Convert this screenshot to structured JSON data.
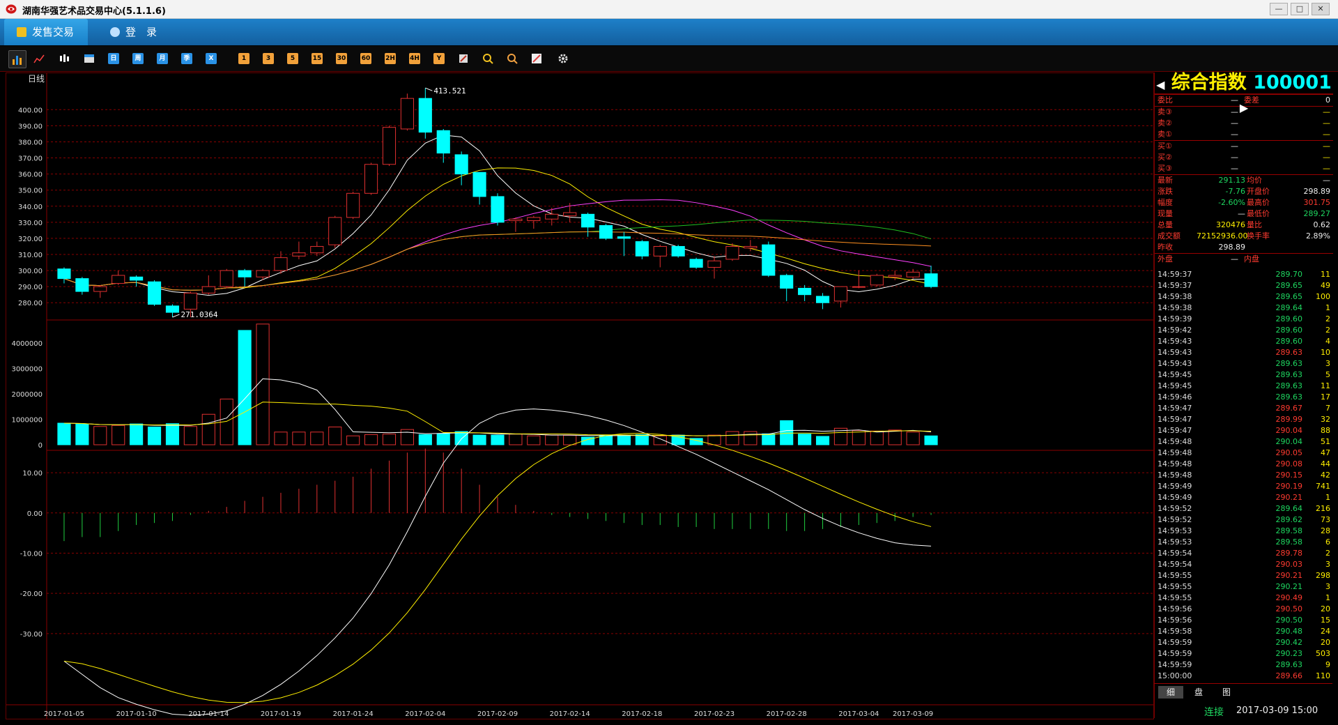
{
  "window": {
    "title": "湖南华强艺术品交易中心(5.1.1.6)",
    "minimize": "—",
    "maximize": "□",
    "close": "✕"
  },
  "nav": {
    "sell_label": "发售交易",
    "login_label": "登　录"
  },
  "toolbar": {
    "periods": [
      "日",
      "周",
      "月",
      "季",
      "X"
    ],
    "minutes": [
      "1",
      "3",
      "5",
      "15",
      "30",
      "60",
      "2H",
      "4H",
      "Y"
    ]
  },
  "chart": {
    "period_label": "日线",
    "high_label": "413.521",
    "low_label": "271.0364"
  },
  "chart_data": {
    "type": "candlestick",
    "price_axis": {
      "ticks": [
        "400.00",
        "390.00",
        "380.00",
        "370.00",
        "360.00",
        "350.00",
        "340.00",
        "330.00",
        "320.00",
        "310.00",
        "300.00",
        "290.00",
        "280.00"
      ],
      "ylim": [
        271,
        414
      ]
    },
    "volume_axis": {
      "ticks": [
        "4000000",
        "3000000",
        "2000000",
        "1000000",
        "0"
      ],
      "ylim": [
        0,
        4800000
      ]
    },
    "macd_axis": {
      "ticks": [
        "10.00",
        "0.00",
        "-10.00",
        "-20.00",
        "-30.00"
      ],
      "ylim": [
        -38,
        14
      ]
    },
    "date_labels": [
      "2017-01-05",
      "2017-01-10",
      "2017-01-14",
      "2017-01-19",
      "2017-01-24",
      "2017-02-04",
      "2017-02-09",
      "2017-02-14",
      "2017-02-18",
      "2017-02-23",
      "2017-02-28",
      "2017-03-04",
      "2017-03-09"
    ],
    "candles": [
      [
        301,
        295,
        302,
        292
      ],
      [
        295,
        287,
        296,
        285
      ],
      [
        287,
        290,
        291,
        283
      ],
      [
        292,
        297,
        300,
        291
      ],
      [
        296,
        294,
        297,
        290
      ],
      [
        293,
        279,
        294,
        278
      ],
      [
        278,
        274,
        279,
        271
      ],
      [
        276,
        286,
        287,
        271
      ],
      [
        286,
        290,
        297,
        285
      ],
      [
        290,
        300,
        301,
        289
      ],
      [
        300,
        296,
        301,
        290
      ],
      [
        296,
        300,
        301,
        294
      ],
      [
        300,
        308,
        312,
        298
      ],
      [
        309,
        311,
        318,
        307
      ],
      [
        311,
        315,
        318,
        309
      ],
      [
        316,
        333,
        334,
        314
      ],
      [
        333,
        348,
        349,
        332
      ],
      [
        348,
        366,
        367,
        347
      ],
      [
        366,
        389,
        390,
        365
      ],
      [
        388,
        407,
        410,
        387
      ],
      [
        407,
        386,
        413.5,
        382
      ],
      [
        387,
        373,
        388,
        367
      ],
      [
        372,
        360,
        374,
        353
      ],
      [
        361,
        346,
        361,
        341
      ],
      [
        346,
        330,
        348,
        328
      ],
      [
        331,
        332,
        333,
        324
      ],
      [
        331,
        333,
        334,
        326
      ],
      [
        332,
        335,
        339,
        328
      ],
      [
        334,
        336,
        342,
        330
      ],
      [
        335,
        327,
        336,
        321
      ],
      [
        328,
        320,
        329,
        319
      ],
      [
        321,
        320,
        324,
        309
      ],
      [
        318,
        309,
        319,
        307
      ],
      [
        309,
        315,
        316,
        302
      ],
      [
        315,
        309,
        316,
        308
      ],
      [
        307,
        302,
        308,
        301
      ],
      [
        302,
        306,
        309,
        295
      ],
      [
        307,
        315,
        317,
        306
      ],
      [
        314,
        315,
        319,
        312
      ],
      [
        316,
        297,
        318,
        296
      ],
      [
        297,
        289,
        298,
        281
      ],
      [
        289,
        285,
        291,
        281
      ],
      [
        284,
        280,
        286,
        276
      ],
      [
        281,
        290,
        290,
        277
      ],
      [
        290,
        290,
        300,
        289
      ],
      [
        291,
        297,
        298,
        290
      ],
      [
        296,
        297,
        300,
        294
      ],
      [
        296,
        299,
        301,
        295
      ],
      [
        298,
        290,
        303,
        289
      ]
    ],
    "volumes": [
      850000,
      820000,
      720000,
      760000,
      820000,
      700000,
      830000,
      720000,
      1200000,
      1800000,
      4500000,
      4750000,
      500000,
      500000,
      500000,
      700000,
      350000,
      400000,
      420000,
      600000,
      400000,
      430000,
      520000,
      380000,
      380000,
      420000,
      350000,
      380000,
      370000,
      300000,
      380000,
      380000,
      400000,
      350000,
      380000,
      250000,
      380000,
      520000,
      520000,
      430000,
      950000,
      420000,
      330000,
      650000,
      560000,
      540000,
      580000,
      500000,
      350000
    ],
    "macd_hist": [
      -7.0,
      -6.0,
      -6.0,
      -4.5,
      -3.0,
      -2.5,
      -2.0,
      -0.5,
      0.5,
      1.5,
      3.0,
      4.0,
      5.0,
      6.0,
      7.0,
      8.0,
      9.0,
      11.0,
      13.0,
      15.0,
      16.0,
      15.0,
      11.0,
      7.0,
      4.0,
      2.0,
      0.5,
      -0.5,
      -1.0,
      -1.5,
      -2.0,
      -2.5,
      -3.0,
      -3.0,
      -3.5,
      -3.5,
      -4.0,
      -4.0,
      -4.0,
      -4.0,
      -4.5,
      -4.5,
      -4.0,
      -3.5,
      -3.0,
      -2.5,
      -2.0,
      -1.0,
      -0.5
    ]
  },
  "panel": {
    "name": "综合指数",
    "code": "100001",
    "wei_bi_label": "委比",
    "wei_bi": "—",
    "wei_cha_label": "委差",
    "wei_cha": "0",
    "asks": [
      {
        "label": "卖③",
        "price": "—",
        "vol": "—"
      },
      {
        "label": "卖②",
        "price": "—",
        "vol": "—"
      },
      {
        "label": "卖①",
        "price": "—",
        "vol": "—"
      }
    ],
    "bids": [
      {
        "label": "买①",
        "price": "—",
        "vol": "—"
      },
      {
        "label": "买②",
        "price": "—",
        "vol": "—"
      },
      {
        "label": "买③",
        "price": "—",
        "vol": "—"
      }
    ],
    "stats": [
      {
        "l1": "最新",
        "v1": "291.13",
        "c1": "green",
        "l2": "均价",
        "v2": "—",
        "c2": "white"
      },
      {
        "l1": "涨跌",
        "v1": "-7.76",
        "c1": "green",
        "l2": "开盘价",
        "v2": "298.89",
        "c2": "white"
      },
      {
        "l1": "幅度",
        "v1": "-2.60%",
        "c1": "green",
        "l2": "最高价",
        "v2": "301.75",
        "c2": "red"
      },
      {
        "l1": "现量",
        "v1": "—",
        "c1": "white",
        "l2": "最低价",
        "v2": "289.27",
        "c2": "green"
      },
      {
        "l1": "总量",
        "v1": "320476",
        "c1": "yellow",
        "l2": "量比",
        "v2": "0.62",
        "c2": "white"
      },
      {
        "l1": "成交额",
        "v1": "72152936.00",
        "c1": "yellow",
        "l2": "换手率",
        "v2": "2.89%",
        "c2": "white"
      },
      {
        "l1": "昨收",
        "v1": "298.89",
        "c1": "white",
        "l2": "",
        "v2": "",
        "c2": "white"
      }
    ],
    "outer_label": "外盘",
    "outer_value": "—",
    "inner_label": "内盘",
    "inner_value": "—",
    "ticks": [
      [
        "14:59:37",
        "289.70",
        "11"
      ],
      [
        "14:59:37",
        "289.65",
        "49"
      ],
      [
        "14:59:38",
        "289.65",
        "100"
      ],
      [
        "14:59:38",
        "289.64",
        "1"
      ],
      [
        "14:59:39",
        "289.60",
        "2"
      ],
      [
        "14:59:42",
        "289.60",
        "2"
      ],
      [
        "14:59:43",
        "289.60",
        "4"
      ],
      [
        "14:59:43",
        "289.63",
        "10"
      ],
      [
        "14:59:43",
        "289.63",
        "3"
      ],
      [
        "14:59:45",
        "289.63",
        "5"
      ],
      [
        "14:59:45",
        "289.63",
        "11"
      ],
      [
        "14:59:46",
        "289.63",
        "17"
      ],
      [
        "14:59:47",
        "289.67",
        "7"
      ],
      [
        "14:59:47",
        "289.99",
        "32"
      ],
      [
        "14:59:47",
        "290.04",
        "88"
      ],
      [
        "14:59:48",
        "290.04",
        "51"
      ],
      [
        "14:59:48",
        "290.05",
        "47"
      ],
      [
        "14:59:48",
        "290.08",
        "44"
      ],
      [
        "14:59:48",
        "290.15",
        "42"
      ],
      [
        "14:59:49",
        "290.19",
        "741"
      ],
      [
        "14:59:49",
        "290.21",
        "1"
      ],
      [
        "14:59:52",
        "289.64",
        "216"
      ],
      [
        "14:59:52",
        "289.62",
        "73"
      ],
      [
        "14:59:53",
        "289.58",
        "28"
      ],
      [
        "14:59:53",
        "289.58",
        "6"
      ],
      [
        "14:59:54",
        "289.78",
        "2"
      ],
      [
        "14:59:54",
        "290.03",
        "3"
      ],
      [
        "14:59:55",
        "290.21",
        "298"
      ],
      [
        "14:59:55",
        "290.21",
        "3"
      ],
      [
        "14:59:55",
        "290.49",
        "1"
      ],
      [
        "14:59:56",
        "290.50",
        "20"
      ],
      [
        "14:59:56",
        "290.50",
        "15"
      ],
      [
        "14:59:58",
        "290.48",
        "24"
      ],
      [
        "14:59:59",
        "290.42",
        "20"
      ],
      [
        "14:59:59",
        "290.23",
        "503"
      ],
      [
        "14:59:59",
        "289.63",
        "9"
      ],
      [
        "15:00:00",
        "289.66",
        "110"
      ]
    ],
    "tabs": [
      "细",
      "盘",
      "图"
    ]
  },
  "status": {
    "connection": "连接",
    "datetime": "2017-03-09 15:00"
  },
  "colors": {
    "up": "#e03030",
    "down": "#00ffff",
    "grid": "#8a0000"
  }
}
